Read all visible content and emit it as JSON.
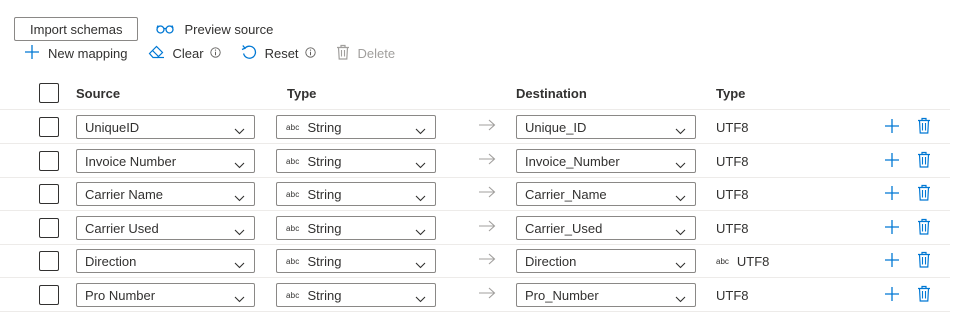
{
  "toolbar": {
    "import_label": "Import schemas",
    "preview_label": "Preview source",
    "new_mapping_label": "New mapping",
    "clear_label": "Clear",
    "reset_label": "Reset",
    "delete_label": "Delete"
  },
  "table": {
    "headers": {
      "source": "Source",
      "type": "Type",
      "destination": "Destination",
      "dest_type": "Type"
    },
    "rows": [
      {
        "source": "UniqueID",
        "type_badge": "abc",
        "type": "String",
        "destination": "Unique_ID",
        "dest_type_badge": "",
        "dest_type": "UTF8"
      },
      {
        "source": "Invoice Number",
        "type_badge": "abc",
        "type": "String",
        "destination": "Invoice_Number",
        "dest_type_badge": "",
        "dest_type": "UTF8"
      },
      {
        "source": "Carrier Name",
        "type_badge": "abc",
        "type": "String",
        "destination": "Carrier_Name",
        "dest_type_badge": "",
        "dest_type": "UTF8"
      },
      {
        "source": "Carrier Used",
        "type_badge": "abc",
        "type": "String",
        "destination": "Carrier_Used",
        "dest_type_badge": "",
        "dest_type": "UTF8"
      },
      {
        "source": "Direction",
        "type_badge": "abc",
        "type": "String",
        "destination": "Direction",
        "dest_type_badge": "abc",
        "dest_type": "UTF8"
      },
      {
        "source": "Pro Number",
        "type_badge": "abc",
        "type": "String",
        "destination": "Pro_Number",
        "dest_type_badge": "",
        "dest_type": "UTF8"
      }
    ]
  },
  "colors": {
    "accent": "#0078d4",
    "disabled": "#a19f9d",
    "border": "#8a8886",
    "divider": "#edebe9"
  }
}
